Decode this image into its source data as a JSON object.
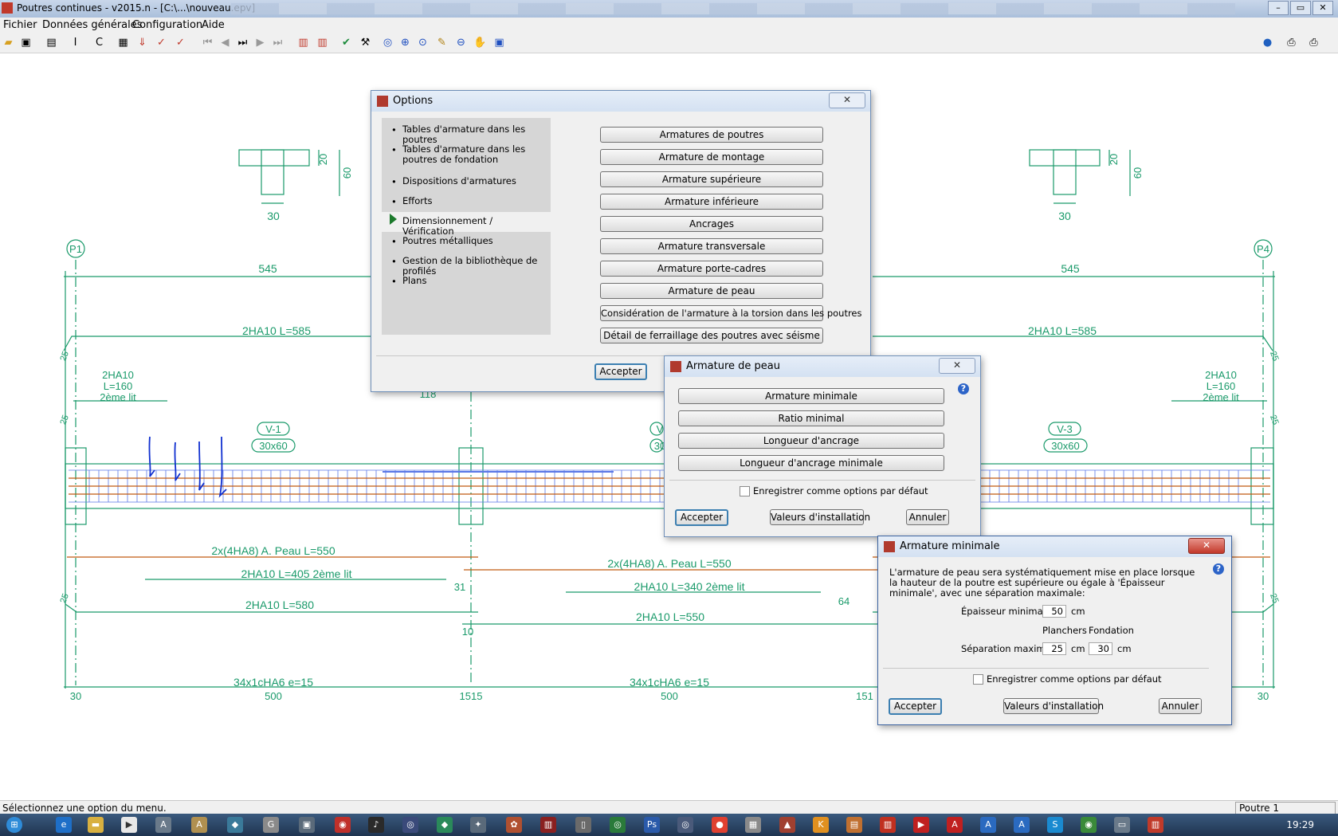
{
  "window": {
    "title": "Poutres continues - v2015.n - [C:\\...\\nouveau.epv]"
  },
  "menu": [
    "Fichier",
    "Données générales",
    "Configuration",
    "Aide"
  ],
  "toolbar_icons": [
    "open-icon",
    "save-icon",
    "table-icon",
    "beam-i-icon",
    "c-icon",
    "properties-icon",
    "import-icon",
    "check-icon",
    "check2-icon",
    "first-icon",
    "prev-icon",
    "step-icon",
    "next-icon",
    "last-icon",
    "grid-icon",
    "grid2-icon",
    "verify-icon",
    "wand-icon",
    "zoom-icon",
    "zoom-in-icon",
    "zoom-window-icon",
    "pen-icon",
    "zoom-out-icon",
    "pan-icon",
    "refresh-icon",
    "globe-icon",
    "print-icon",
    "print2-icon"
  ],
  "drawing": {
    "supports": [
      "P1",
      "P4"
    ],
    "section_left": {
      "w": "30",
      "h1": "20",
      "h2": "60"
    },
    "section_right": {
      "w": "30",
      "h1": "20",
      "h2": "60"
    },
    "spans": [
      "545",
      "545"
    ],
    "top_bars": [
      "2HA10 L=585",
      "2HA10 L=585"
    ],
    "left_2nd": [
      "2HA10",
      "L=160",
      "2ème lit"
    ],
    "right_2nd": [
      "2HA10",
      "L=160",
      "2ème lit"
    ],
    "dim118": "118",
    "beam_tags": [
      {
        "name": "V-1",
        "size": "30x60"
      },
      {
        "name": "V-3",
        "size": "30x60"
      }
    ],
    "tag_v2_partial": [
      "V",
      "30"
    ],
    "side25": "25",
    "bottom_texts": {
      "peau1": "2x(4HA8) A. Peau L=550",
      "peau2": "2x(4HA8) A. Peau L=550",
      "b405": "2HA10 L=405 2ème lit",
      "b340": "2HA10 L=340 2ème lit",
      "b580": "2HA10 L=580",
      "b550": "2HA10 L=550",
      "d31": "31",
      "d64": "64",
      "d10": "10",
      "stirrups1": "34x1cHA6 e=15",
      "stirrups2": "34x1cHA6 e=15"
    },
    "bottom_dims": [
      "30",
      "500",
      "1515",
      "500",
      "151",
      "30"
    ]
  },
  "options_dialog": {
    "title": "Options",
    "nav": [
      "Tables d'armature dans les poutres",
      "Tables d'armature dans les poutres de fondation",
      "Dispositions d'armatures",
      "Efforts",
      "Dimensionnement / Vérification",
      "Poutres métalliques",
      "Gestion de la bibliothèque de profilés",
      "Plans"
    ],
    "selected_index": 4,
    "buttons": [
      "Armatures de poutres",
      "Armature de montage",
      "Armature supérieure",
      "Armature inférieure",
      "Ancrages",
      "Armature transversale",
      "Armature porte-cadres",
      "Armature de peau",
      "Considération de l'armature à la torsion dans les poutres",
      "Détail de ferraillage des poutres avec séisme"
    ],
    "accept": "Accepter"
  },
  "peau_dialog": {
    "title": "Armature de peau",
    "buttons": [
      "Armature minimale",
      "Ratio minimal",
      "Longueur d'ancrage",
      "Longueur d'ancrage minimale"
    ],
    "save_default": "Enregistrer comme options par défaut",
    "accept": "Accepter",
    "install": "Valeurs d'installation",
    "cancel": "Annuler"
  },
  "minimale_dialog": {
    "title": "Armature minimale",
    "description": "L'armature de peau sera systématiquement mise en place lorsque la hauteur de la poutre est supérieure ou égale à 'Épaisseur minimale', avec une séparation maximale:",
    "epaisseur_label": "Épaisseur minimale",
    "epaisseur_value": "50",
    "unit": "cm",
    "col_planchers": "Planchers",
    "col_fondation": "Fondation",
    "separation_label": "Séparation maximale",
    "planchers_value": "25",
    "fondation_value": "30",
    "save_default": "Enregistrer comme options par défaut",
    "accept": "Accepter",
    "install": "Valeurs d'installation",
    "cancel": "Annuler"
  },
  "status": {
    "message": "Sélectionnez une option du menu.",
    "pane": "Poutre 1"
  },
  "clock": "19:29",
  "colors": {
    "drawing_green": "#1a9a6a",
    "rebar_orange": "#c05a10",
    "stirrup_blue": "#5a78e6",
    "ink_blue": "#1030d0"
  }
}
